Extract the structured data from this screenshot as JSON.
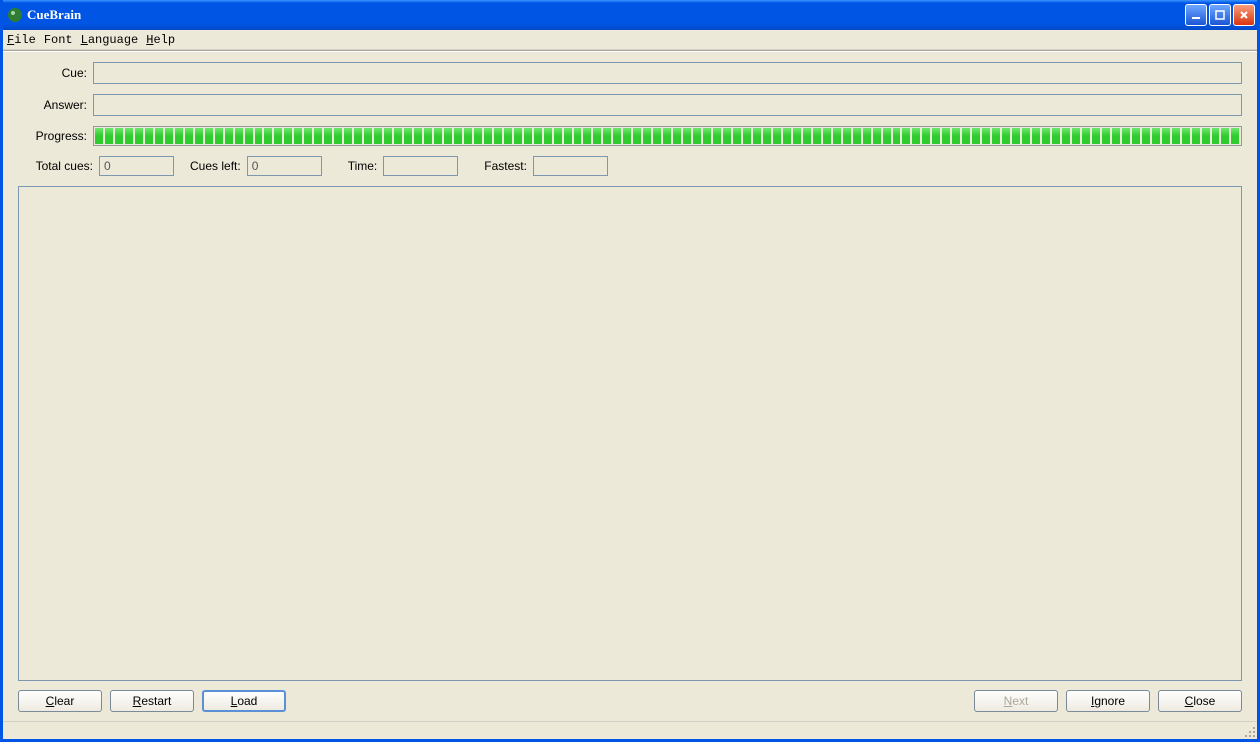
{
  "window": {
    "title": "CueBrain"
  },
  "menu": {
    "file": "File",
    "font": "Font",
    "language": "Language",
    "help": "Help"
  },
  "labels": {
    "cue": "Cue:",
    "answer": "Answer:",
    "progress": "Progress:",
    "total_cues": "Total cues:",
    "cues_left": "Cues left:",
    "time": "Time:",
    "fastest": "Fastest:"
  },
  "values": {
    "cue": "",
    "answer": "",
    "total_cues": "0",
    "cues_left": "0",
    "time": "",
    "fastest": ""
  },
  "buttons": {
    "clear": "Clear",
    "restart": "Restart",
    "load": "Load",
    "next": "Next",
    "ignore": "Ignore",
    "close": "Close"
  }
}
